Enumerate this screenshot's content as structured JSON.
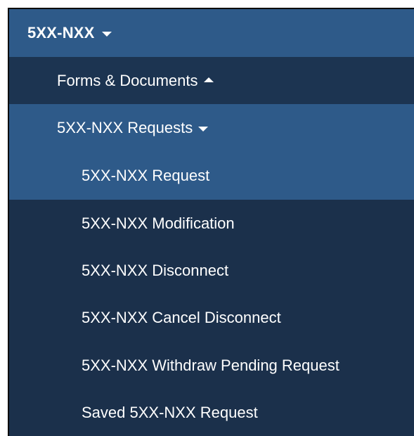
{
  "menu": {
    "top": {
      "label": "5XX-NXX",
      "icon": "caret-down-icon"
    },
    "forms": {
      "label": "Forms & Documents",
      "icon": "caret-up-icon"
    },
    "requests": {
      "label": "5XX-NXX Requests",
      "icon": "caret-down-icon"
    },
    "items": [
      {
        "label": "5XX-NXX Request"
      },
      {
        "label": "5XX-NXX Modification"
      },
      {
        "label": "5XX-NXX Disconnect"
      },
      {
        "label": "5XX-NXX Cancel Disconnect"
      },
      {
        "label": "5XX-NXX Withdraw Pending Request"
      },
      {
        "label": "Saved 5XX-NXX Request"
      }
    ]
  },
  "colors": {
    "header_bg": "#2e5a89",
    "menu_bg": "#1b304b",
    "active_bg": "#2e5a89",
    "text": "#ffffff"
  }
}
